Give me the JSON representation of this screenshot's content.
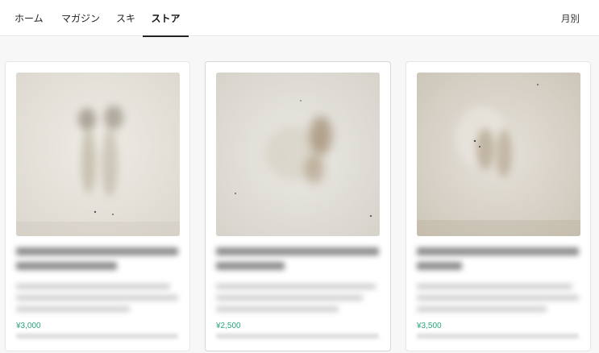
{
  "nav": {
    "tabs": [
      {
        "label": "ホーム"
      },
      {
        "label": "マガジン"
      },
      {
        "label": "スキ"
      },
      {
        "label": "ストア",
        "active": true
      }
    ],
    "period_label": "月別"
  },
  "colors": {
    "accent_price": "#2aa77a",
    "active_underline": "#222222"
  },
  "store": {
    "items": [
      {
        "price": "¥3,000"
      },
      {
        "price": "¥2,500"
      },
      {
        "price": "¥3,500"
      }
    ]
  }
}
